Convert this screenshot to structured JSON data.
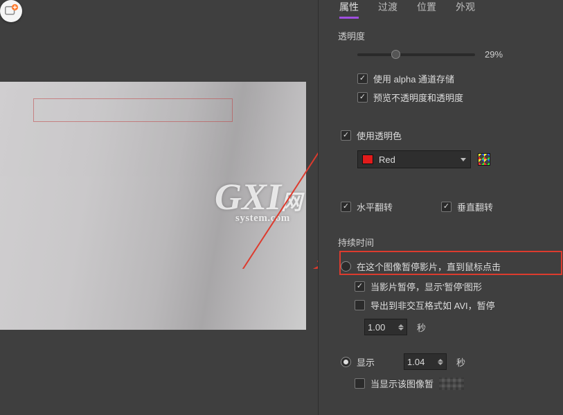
{
  "toolbar": {
    "add_icon": "add-plus-icon"
  },
  "tabs": [
    {
      "label": "属性",
      "active": true
    },
    {
      "label": "过渡",
      "active": false
    },
    {
      "label": "位置",
      "active": false
    },
    {
      "label": "外观",
      "active": false
    }
  ],
  "opacity": {
    "title": "透明度",
    "value_text": "29%",
    "percent": 29,
    "use_alpha_label": "使用 alpha 通道存储",
    "use_alpha_checked": true,
    "preview_label": "预览不透明度和透明度",
    "preview_checked": true
  },
  "transparent_color": {
    "enable_label": "使用透明色",
    "enable_checked": true,
    "color_name": "Red",
    "color_hex": "#e21b1b"
  },
  "flip": {
    "h_label": "水平翻转",
    "h_checked": true,
    "v_label": "垂直翻转",
    "v_checked": true
  },
  "duration": {
    "title": "持续时间",
    "pause_option_label": "在这个图像暂停影片，直到鼠标点击",
    "pause_selected": false,
    "show_pause_graphic_label": "当影片暂停，显示'暂停'图形",
    "show_pause_graphic_checked": true,
    "export_label": "导出到非交互格式如 AVI，暂停",
    "export_checked": false,
    "export_value": "1.00",
    "export_unit": "秒",
    "display_option_label": "显示",
    "display_selected": true,
    "display_value": "1.04",
    "display_unit": "秒",
    "when_display_label_prefix": "当显示该图像暂",
    "when_display_checked": false
  },
  "watermark": {
    "big": "GXI",
    "suffix": "网",
    "sub": "system.com"
  }
}
